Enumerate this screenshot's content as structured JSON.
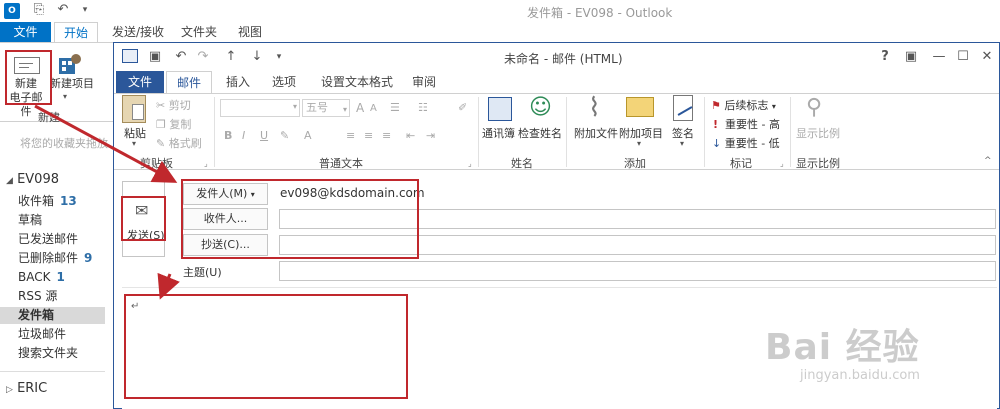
{
  "bg_window": {
    "title": "发件箱 - EV098 - Outlook",
    "logo_text": "O",
    "tabs": [
      "文件",
      "开始",
      "发送/接收",
      "文件夹",
      "视图"
    ],
    "new_mail_label_1": "新建",
    "new_mail_label_2": "电子邮件",
    "new_item_label": "新建项目",
    "new_group_label": "新建",
    "favorites_hint": "将您的收藏夹拖放..."
  },
  "nav": {
    "account": "EV098",
    "items": [
      {
        "label": "收件箱",
        "count": "13"
      },
      {
        "label": "草稿",
        "count": ""
      },
      {
        "label": "已发送邮件",
        "count": ""
      },
      {
        "label": "已删除邮件",
        "count": "9"
      },
      {
        "label": "BACK",
        "count": "1"
      },
      {
        "label": "RSS 源",
        "count": ""
      },
      {
        "label": "发件箱",
        "count": ""
      },
      {
        "label": "垃圾邮件",
        "count": ""
      },
      {
        "label": "搜索文件夹",
        "count": ""
      }
    ],
    "second_account": "ERIC"
  },
  "compose": {
    "title": "未命名 - 邮件 (HTML)",
    "window_controls": [
      "?",
      "▣",
      "—",
      "☐",
      "✕"
    ],
    "tabs": [
      "文件",
      "邮件",
      "插入",
      "选项",
      "设置文本格式",
      "审阅"
    ],
    "ribbon": {
      "paste": "粘贴",
      "cut": "剪切",
      "copy": "复制",
      "format_painter": "格式刷",
      "clipboard_group": "剪贴板",
      "font_size": "五号",
      "basic_text_group": "普通文本",
      "address_book": "通讯簿",
      "check_names": "检查姓名",
      "names_group": "姓名",
      "attach_file": "附加文件",
      "attach_item": "附加项目",
      "signature": "签名",
      "include_group": "添加",
      "follow_up": "后续标志",
      "high_importance": "重要性 - 高",
      "low_importance": "重要性 - 低",
      "tags_group": "标记",
      "zoom": "显示比例",
      "zoom_group": "显示比例"
    },
    "send_label": "发送(S)",
    "from_button": "发件人(M)",
    "from_value": "ev098@kdsdomain.com",
    "to_button": "收件人...",
    "cc_button": "抄送(C)...",
    "subject_label": "主题(U)",
    "body_mark": "↵"
  },
  "watermark": {
    "text": "Bai 经验",
    "url": "jingyan.baidu.com"
  },
  "colors": {
    "outlook_blue": "#0072c6",
    "word_blue": "#2b579a",
    "annotation_red": "#c0282d"
  }
}
